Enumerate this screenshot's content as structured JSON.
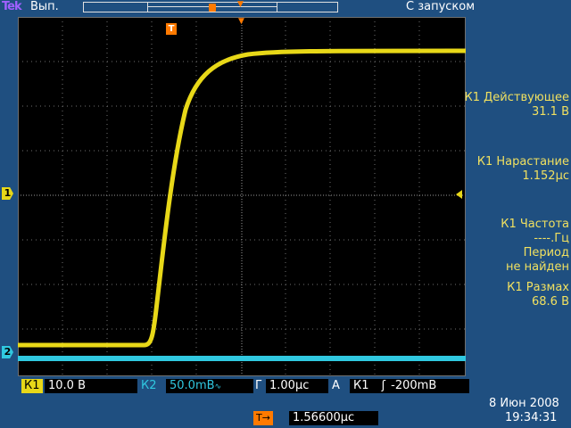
{
  "header": {
    "brand": "Tek",
    "run_state": "Вып.",
    "acq_mode": "С запуском"
  },
  "measurements": [
    {
      "title": "К1 Действующее",
      "value": "31.1 В"
    },
    {
      "title": "К1 Нарастание",
      "value": "1.152µс"
    },
    {
      "title": "К1 Частота",
      "value": "----.Гц"
    },
    {
      "title": "Период",
      "value": "не найден"
    },
    {
      "title": "К1 Размах",
      "value": "68.6 В"
    }
  ],
  "channels": {
    "ch1_marker": "1",
    "ch2_marker": "2",
    "trigger_marker": "T"
  },
  "bottom": {
    "ch1_label": "К1",
    "ch1_scale": "10.0 В",
    "ch2_label": "К2",
    "ch2_scale": "50.0mВ",
    "ch2_coupling_icon": "ac-coupling-icon",
    "timebase_label": "Г",
    "timebase_value": "1.00µс",
    "trig_label": "A",
    "trig_source": "К1",
    "trig_slope_icon": "rising-edge-icon",
    "trig_level": "-200mВ",
    "trig_offset_label": "T→",
    "trig_offset": "1.56600µс",
    "date": "8 Июн 2008",
    "time": "19:34:31"
  },
  "colors": {
    "ch1": "#e8d818",
    "ch2": "#30c8e0",
    "trigger": "#ff7a00",
    "background": "#1f4f80",
    "screen": "#000000"
  }
}
